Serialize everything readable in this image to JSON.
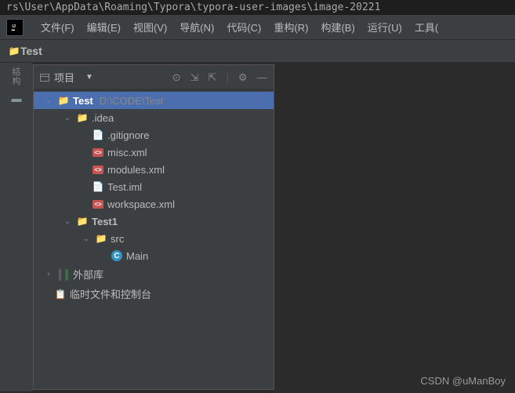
{
  "path_bar": "rs\\User\\AppData\\Roaming\\Typora\\typora-user-images\\image-20221",
  "menu": {
    "file": "文件(F)",
    "edit": "编辑(E)",
    "view": "视图(V)",
    "navigate": "导航(N)",
    "code": "代码(C)",
    "refactor": "重构(R)",
    "build": "构建(B)",
    "run": "运行(U)",
    "tools": "工具("
  },
  "breadcrumb": {
    "project": "Test"
  },
  "gutter": {
    "structure": "结构",
    "project": "■"
  },
  "panel": {
    "title": "项目"
  },
  "tree": {
    "root": {
      "name": "Test",
      "path": "D:\\CODE\\Test"
    },
    "idea": ".idea",
    "gitignore": ".gitignore",
    "misc": "misc.xml",
    "modules": "modules.xml",
    "testiml": "Test.iml",
    "workspace": "workspace.xml",
    "test1": "Test1",
    "src": "src",
    "main": "Main",
    "external": "外部库",
    "scratch": "临时文件和控制台"
  },
  "watermark": "CSDN @uManBoy"
}
